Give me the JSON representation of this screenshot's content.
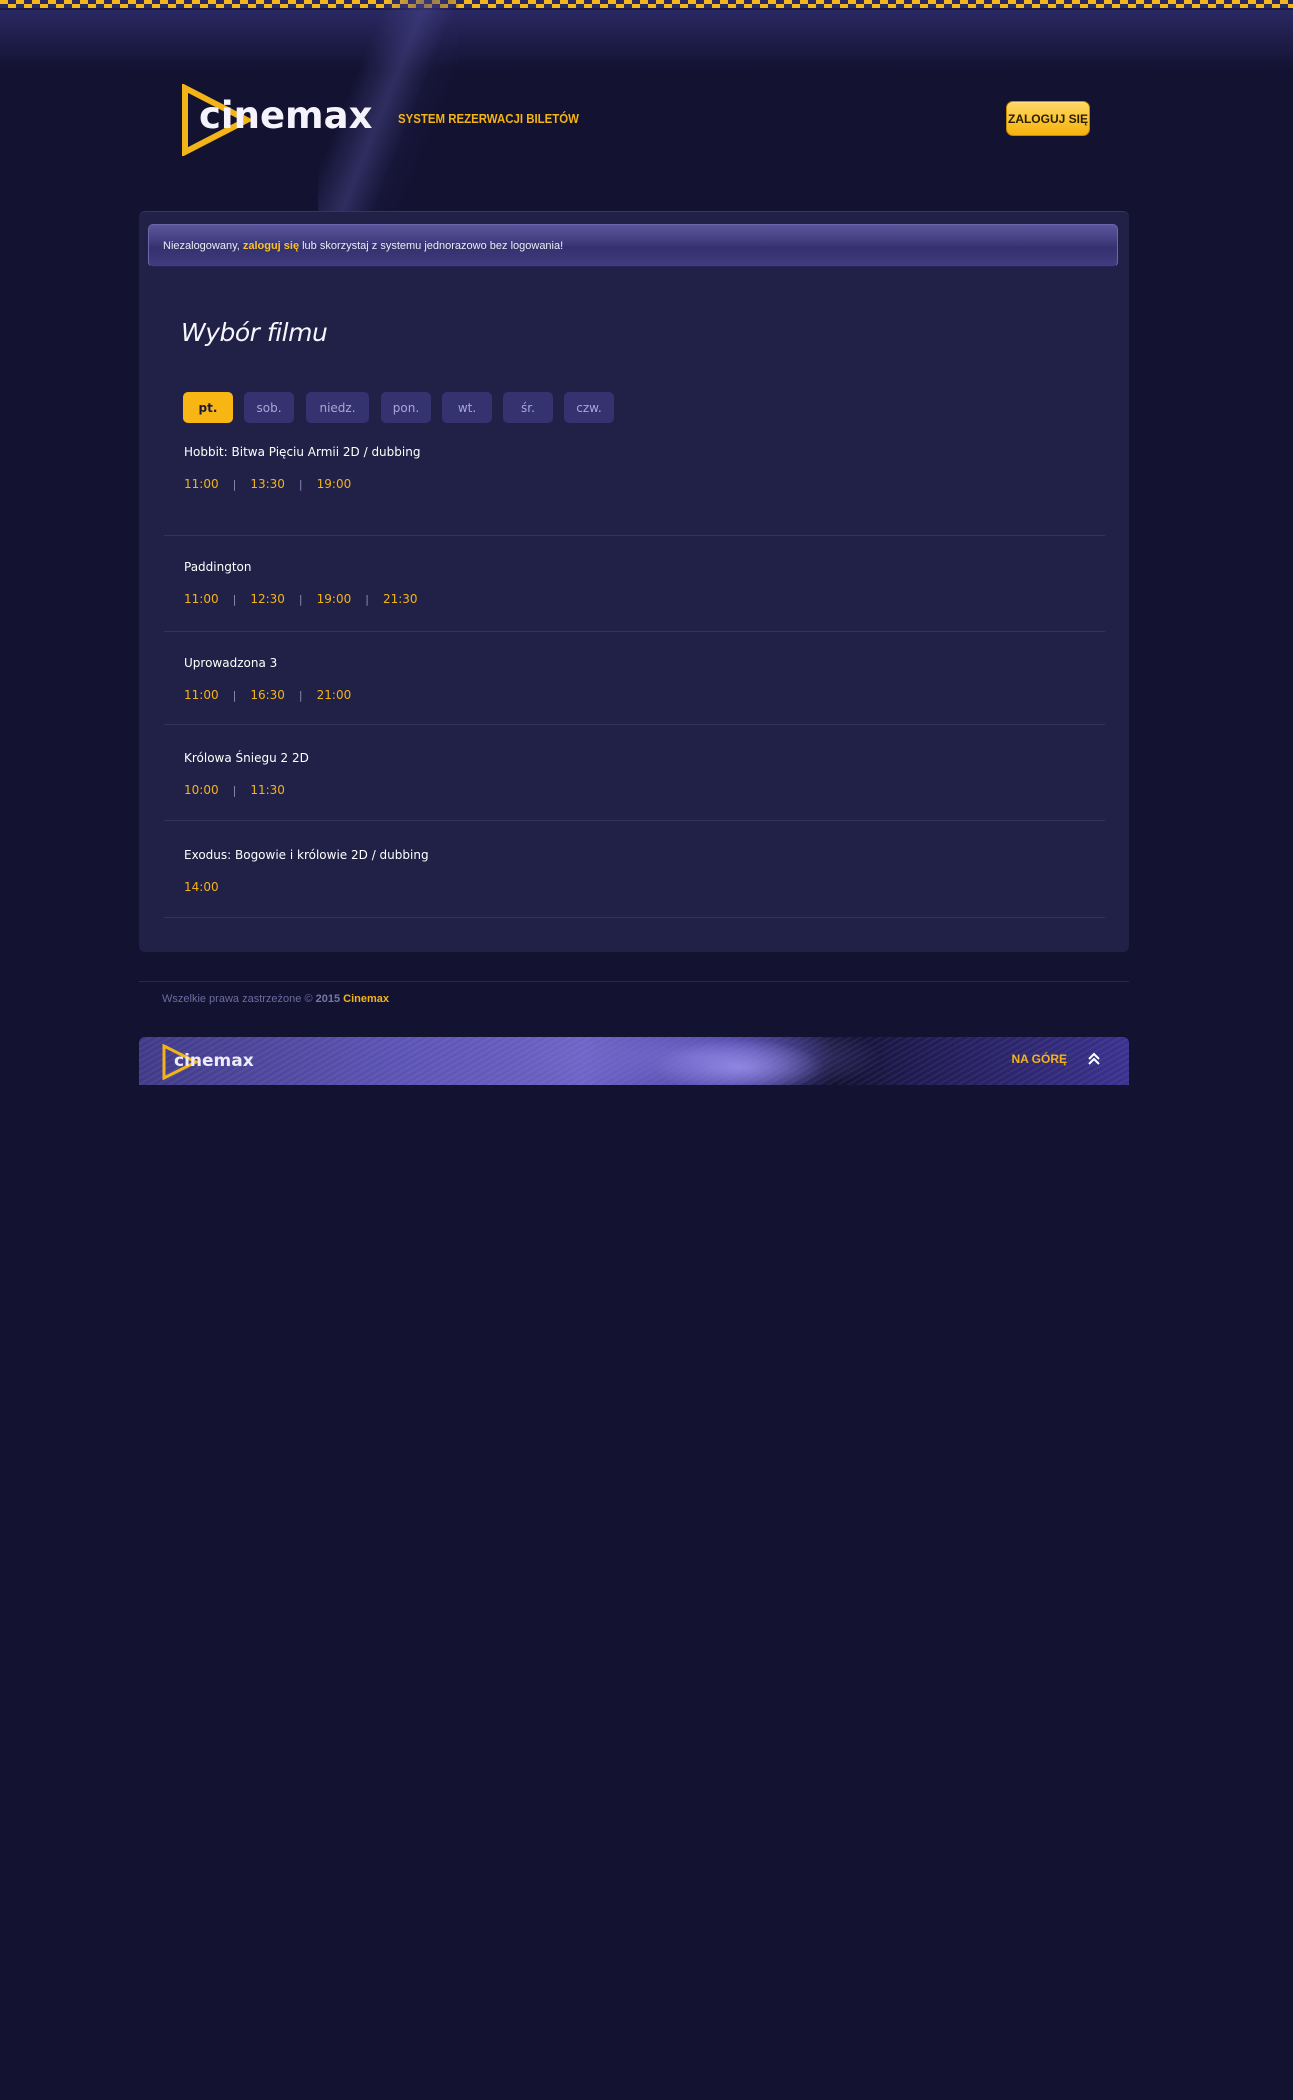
{
  "header": {
    "logo_text": "cinemax",
    "tagline": "SYSTEM REZERWACJI BILETÓW",
    "login_button": "ZALOGUJ SIĘ"
  },
  "notice": {
    "before": "Niezalogowany,",
    "link": "zaloguj się",
    "after": "lub skorzystaj z systemu jednorazowo bez logowania!"
  },
  "page_title": "Wybór filmu",
  "days": [
    {
      "label": "pt.",
      "active": true
    },
    {
      "label": "sob.",
      "active": false
    },
    {
      "label": "niedz.",
      "active": false
    },
    {
      "label": "pon.",
      "active": false
    },
    {
      "label": "wt.",
      "active": false
    },
    {
      "label": "śr.",
      "active": false
    },
    {
      "label": "czw.",
      "active": false
    }
  ],
  "films": [
    {
      "title": "Hobbit: Bitwa Pięciu Armii 2D / dubbing",
      "times": [
        "11:00",
        "13:30",
        "19:00"
      ]
    },
    {
      "title": "Paddington",
      "times": [
        "11:00",
        "12:30",
        "19:00",
        "21:30"
      ]
    },
    {
      "title": "Uprowadzona 3",
      "times": [
        "11:00",
        "16:30",
        "21:00"
      ]
    },
    {
      "title": "Królowa Śniegu 2 2D",
      "times": [
        "10:00",
        "11:30"
      ]
    },
    {
      "title": "Exodus: Bogowie i królowie 2D / dubbing",
      "times": [
        "14:00"
      ]
    }
  ],
  "footer": {
    "copyright_text": "Wszelkie prawa zastrzeżone ©",
    "year": "2015",
    "brand": "Cinemax",
    "banner_logo": "cinemax",
    "back_to_top": "NA GÓRĘ"
  },
  "colors": {
    "background": "#131231",
    "panel": "#212046",
    "accent": "#f3b418",
    "day_inactive": "#35336f"
  }
}
